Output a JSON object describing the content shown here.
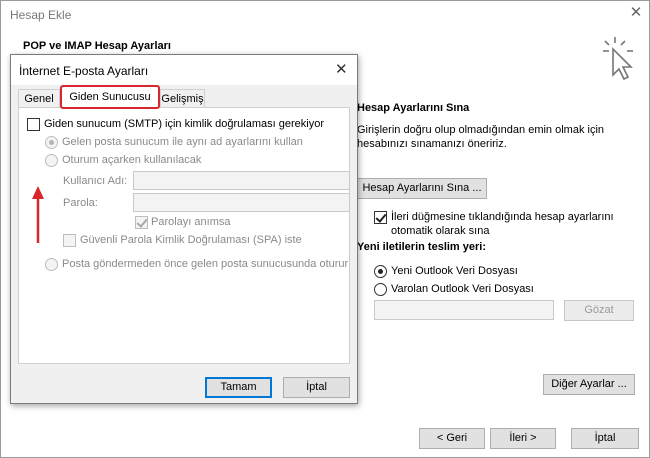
{
  "outer": {
    "title": "Hesap Ekle",
    "close": "✕",
    "heading": "POP ve IMAP Hesap Ayarları",
    "test_section": {
      "title": "Hesap Ayarlarını Sına",
      "desc_line1": "Girişlerin doğru olup olmadığından emin olmak için",
      "desc_line2": "hesabınızı sınamanızı öneririz.",
      "test_button": "Hesap Ayarlarını Sına ...",
      "auto_test_line1": "İleri düğmesine tıklandığında hesap ayarlarını",
      "auto_test_line2": "otomatik olarak sına",
      "auto_test_checked": true
    },
    "delivery": {
      "title": "Yeni iletilerin teslim yeri:",
      "option_new": "Yeni Outlook Veri Dosyası",
      "option_existing": "Varolan Outlook Veri Dosyası",
      "selected": "new",
      "browse_button": "Gözat"
    },
    "more_settings_button": "Diğer Ayarlar ...",
    "back_button": "< Geri",
    "next_button": "İleri >",
    "cancel_button": "İptal"
  },
  "inner": {
    "title": "İnternet E-posta Ayarları",
    "close": "✕",
    "tabs": [
      {
        "label": "Genel",
        "active": false
      },
      {
        "label": "Giden Sunucusu",
        "active": true
      },
      {
        "label": "Gelişmiş",
        "active": false
      }
    ],
    "smtp_auth_label": "Giden sunucum (SMTP) için kimlik doğrulaması gerekiyor",
    "smtp_auth_checked": false,
    "same_settings_label": "Gelen posta sunucum ile aynı ad ayarlarını kullan",
    "logon_using_label": "Oturum açarken kullanılacak",
    "username_label": "Kullanıcı Adı:",
    "username_value": "",
    "password_label": "Parola:",
    "password_value": "",
    "remember_password_label": "Parolayı anımsa",
    "remember_password_checked": true,
    "spa_label": "Güvenli Parola Kimlik Doğrulaması (SPA) iste",
    "spa_checked": false,
    "logon_incoming_first_label": "Posta göndermeden önce gelen posta sunucusunda oturur",
    "ok_button": "Tamam",
    "cancel_button": "İptal"
  },
  "colors": {
    "highlight_red": "#d9262c",
    "default_button_blue": "#0078d7"
  }
}
